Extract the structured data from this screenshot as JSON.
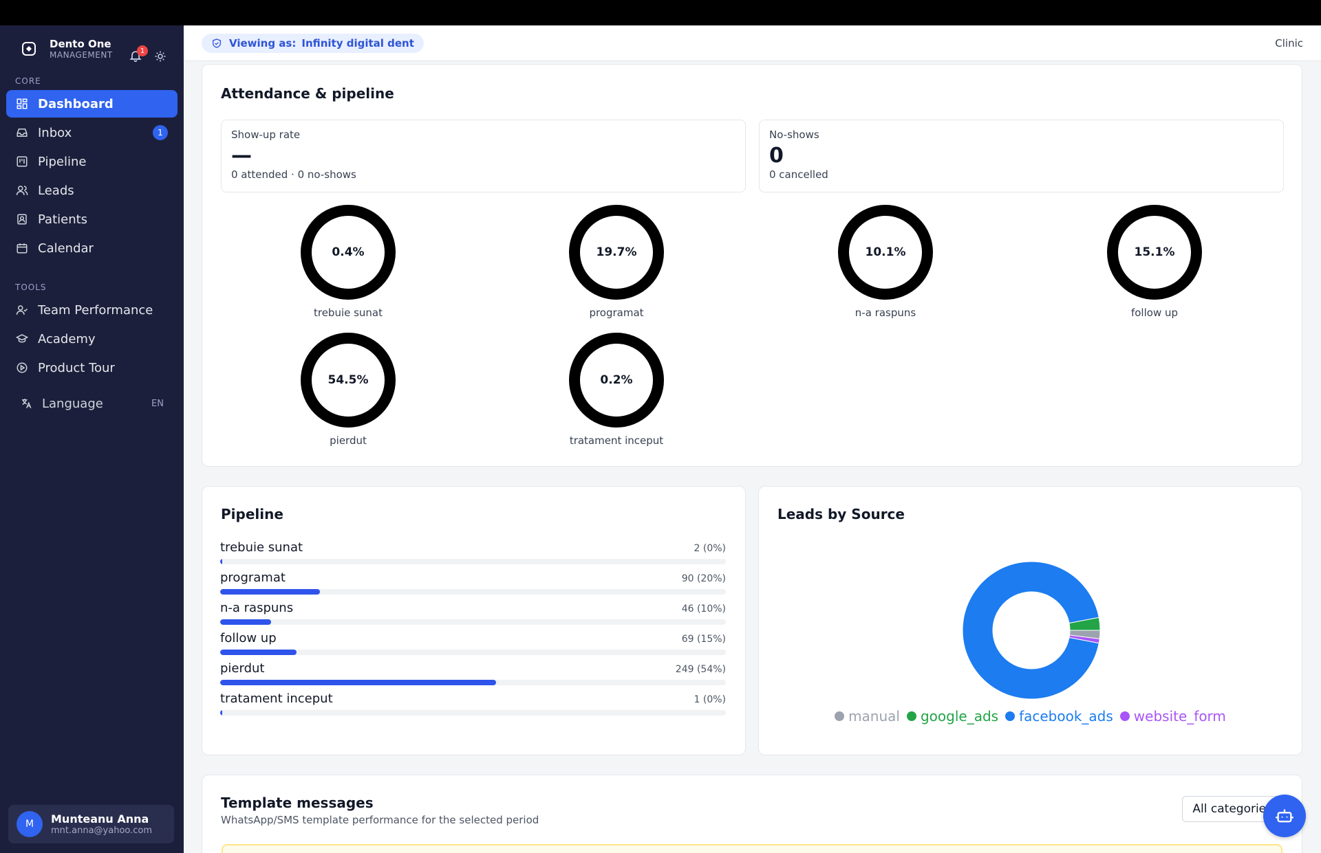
{
  "brand": {
    "name": "Dento One",
    "subtitle": "MANAGEMENT",
    "notification_count": "1"
  },
  "sidebar": {
    "core_title": "CORE",
    "core_items": [
      {
        "label": "Dashboard",
        "icon": "dashboard-icon",
        "active": true
      },
      {
        "label": "Inbox",
        "icon": "inbox-icon",
        "badge": "1"
      },
      {
        "label": "Pipeline",
        "icon": "pipeline-icon"
      },
      {
        "label": "Leads",
        "icon": "leads-icon"
      },
      {
        "label": "Patients",
        "icon": "patients-icon"
      },
      {
        "label": "Calendar",
        "icon": "calendar-icon"
      }
    ],
    "tools_title": "TOOLS",
    "tools_items": [
      {
        "label": "Team Performance",
        "icon": "team-icon"
      },
      {
        "label": "Academy",
        "icon": "academy-icon"
      },
      {
        "label": "Product Tour",
        "icon": "play-icon"
      }
    ],
    "language_label": "Language",
    "language_code": "EN"
  },
  "user": {
    "initial": "M",
    "name": "Munteanu Anna",
    "email": "mnt.anna@yahoo.com"
  },
  "topbar": {
    "viewing_label": "Viewing as:",
    "viewing_value": "Infinity digital dent",
    "right_label": "Clinic"
  },
  "attendance": {
    "title": "Attendance & pipeline",
    "showup": {
      "label": "Show-up rate",
      "value": "—",
      "sub": "0 attended · 0 no-shows"
    },
    "noshows": {
      "label": "No-shows",
      "value": "0",
      "sub": "0 cancelled"
    },
    "rings": [
      {
        "value": "0.4%",
        "label": "trebuie sunat"
      },
      {
        "value": "19.7%",
        "label": "programat"
      },
      {
        "value": "10.1%",
        "label": "n-a raspuns"
      },
      {
        "value": "15.1%",
        "label": "follow up"
      },
      {
        "value": "54.5%",
        "label": "pierdut"
      },
      {
        "value": "0.2%",
        "label": "tratament inceput"
      }
    ]
  },
  "pipeline": {
    "title": "Pipeline",
    "rows": [
      {
        "name": "trebuie sunat",
        "count": "2 (0%)",
        "fraction": 0.004
      },
      {
        "name": "programat",
        "count": "90 (20%)",
        "fraction": 0.197
      },
      {
        "name": "n-a raspuns",
        "count": "46 (10%)",
        "fraction": 0.101
      },
      {
        "name": "follow up",
        "count": "69 (15%)",
        "fraction": 0.151
      },
      {
        "name": "pierdut",
        "count": "249 (54%)",
        "fraction": 0.545
      },
      {
        "name": "tratament inceput",
        "count": "1 (0%)",
        "fraction": 0.002
      }
    ]
  },
  "leads_by_source": {
    "title": "Leads by Source",
    "legend": [
      {
        "label": "manual",
        "color": "#9ca3af"
      },
      {
        "label": "google_ads",
        "color": "#22a447"
      },
      {
        "label": "facebook_ads",
        "color": "#1c7cf0"
      },
      {
        "label": "website_form",
        "color": "#a855f7"
      }
    ]
  },
  "chart_data": {
    "type": "pie",
    "title": "Leads by Source",
    "categories": [
      "facebook_ads",
      "google_ads",
      "manual",
      "website_form"
    ],
    "values": [
      94,
      3,
      2,
      1
    ],
    "colors": [
      "#1c7cf0",
      "#22a447",
      "#9ca3af",
      "#a855f7"
    ]
  },
  "templates": {
    "title": "Template messages",
    "subtitle": "WhatsApp/SMS template performance for the selected period",
    "filter_label": "All categories"
  }
}
